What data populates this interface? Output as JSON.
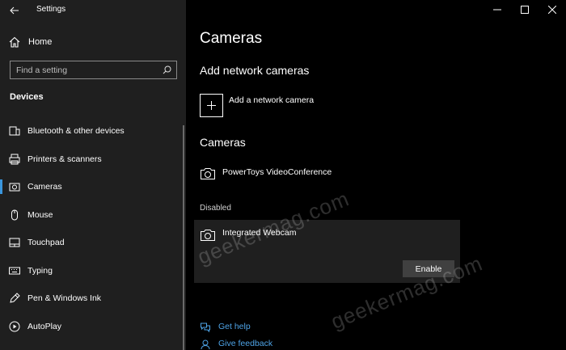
{
  "window": {
    "title": "Settings"
  },
  "sidebar": {
    "home_label": "Home",
    "search": {
      "placeholder": "Find a setting"
    },
    "section": "Devices",
    "items": [
      {
        "label": "Bluetooth & other devices",
        "icon": "bluetooth-devices-icon"
      },
      {
        "label": "Printers & scanners",
        "icon": "printer-icon"
      },
      {
        "label": "Cameras",
        "icon": "camera-icon",
        "active": true
      },
      {
        "label": "Mouse",
        "icon": "mouse-icon"
      },
      {
        "label": "Touchpad",
        "icon": "touchpad-icon"
      },
      {
        "label": "Typing",
        "icon": "keyboard-icon"
      },
      {
        "label": "Pen & Windows Ink",
        "icon": "pen-icon"
      },
      {
        "label": "AutoPlay",
        "icon": "autoplay-icon"
      }
    ]
  },
  "main": {
    "title": "Cameras",
    "add_section": {
      "heading": "Add network cameras",
      "add_label": "Add a network camera"
    },
    "cameras_section": {
      "heading": "Cameras",
      "items": [
        {
          "name": "PowerToys VideoConference"
        }
      ],
      "disabled_label": "Disabled",
      "disabled_items": [
        {
          "name": "Integrated Webcam",
          "action": "Enable"
        }
      ]
    },
    "links": {
      "help": "Get help",
      "feedback": "Give feedback"
    },
    "watermark": "geekermag.com"
  },
  "colors": {
    "accent": "#3a96dd",
    "link": "#4ea3e6",
    "sidebar_bg": "#1f1f1f",
    "main_bg": "#000000"
  }
}
